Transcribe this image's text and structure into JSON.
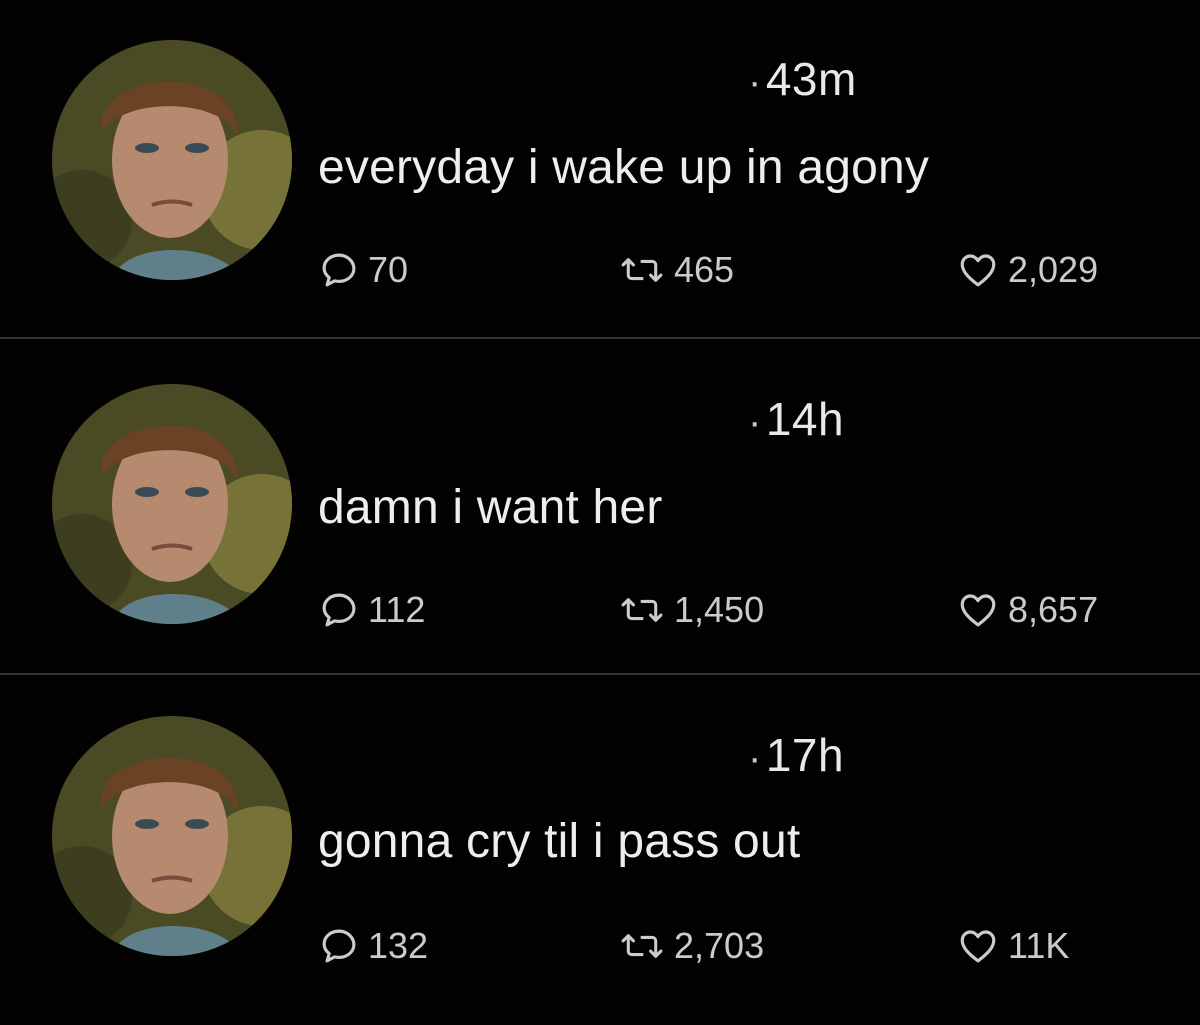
{
  "tweets": [
    {
      "time": "43m",
      "text": "everyday i wake up in agony",
      "replies": "70",
      "retweets": "465",
      "likes": "2,029",
      "avatar_icon": "profile-photo"
    },
    {
      "time": "14h",
      "text": "damn i want her",
      "replies": "112",
      "retweets": "1,450",
      "likes": "8,657",
      "avatar_icon": "profile-photo"
    },
    {
      "time": "17h",
      "text": "gonna cry til i pass out",
      "replies": "132",
      "retweets": "2,703",
      "likes": "11K",
      "avatar_icon": "profile-photo"
    }
  ],
  "icons": {
    "reply": "reply-icon",
    "retweet": "retweet-icon",
    "like": "heart-icon"
  },
  "colors": {
    "background": "#000000",
    "text": "#e7e9ea",
    "icon": "#c9cbcc",
    "divider": "#2f3336"
  }
}
